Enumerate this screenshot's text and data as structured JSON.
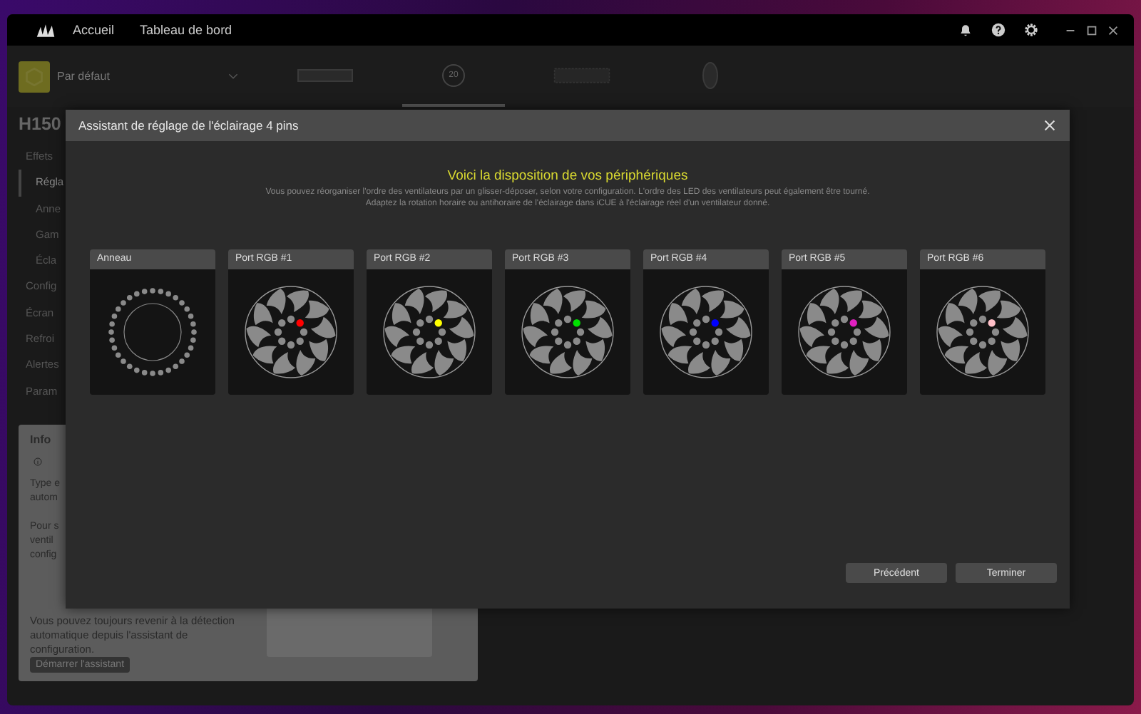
{
  "topbar": {
    "nav": [
      {
        "label": "Accueil"
      },
      {
        "label": "Tableau de bord"
      }
    ]
  },
  "profile": {
    "name": "Par défaut"
  },
  "devices": [
    {
      "kind": "ram",
      "selected": false
    },
    {
      "kind": "cooler",
      "label": "20",
      "selected": true
    },
    {
      "kind": "keyboard",
      "selected": false
    },
    {
      "kind": "mouse",
      "selected": false
    }
  ],
  "device_title": "H150",
  "sidebar": {
    "items": [
      {
        "label": "Effets",
        "selected": false,
        "children": [
          {
            "label": "Régla",
            "selected": true
          },
          {
            "label": "Anne",
            "selected": false
          },
          {
            "label": "Gam",
            "selected": false
          },
          {
            "label": "Écla",
            "selected": false
          }
        ]
      },
      {
        "label": "Config",
        "selected": false
      },
      {
        "label": "Écran",
        "selected": false
      },
      {
        "label": "Refroi",
        "selected": false
      },
      {
        "label": "Alertes",
        "selected": false
      },
      {
        "label": "Param",
        "selected": false
      }
    ]
  },
  "info": {
    "title": "Info",
    "lines": [
      "Type e",
      "autom",
      "Pour s",
      "ventil",
      "config"
    ],
    "paragraph": "Vous pouvez toujours revenir à la détection automatique depuis l'assistant de configuration.",
    "button": "Démarrer l'assistant"
  },
  "modal": {
    "title": "Assistant de réglage de l'éclairage 4 pins",
    "heading": "Voici la disposition de vos périphériques",
    "description": [
      "Vous pouvez réorganiser l'ordre des ventilateurs par un glisser-déposer, selon votre configuration. L'ordre des LED des ventilateurs peut également être tourné.",
      "Adaptez la rotation horaire ou antihoraire de l'éclairage dans iCUE à l'éclairage réel d'un ventilateur donné."
    ],
    "cards": [
      {
        "label": "Anneau",
        "kind": "ring"
      },
      {
        "label": "Port RGB #1",
        "kind": "fan",
        "color": "#ff0000"
      },
      {
        "label": "Port RGB #2",
        "kind": "fan",
        "color": "#ffff00"
      },
      {
        "label": "Port RGB #3",
        "kind": "fan",
        "color": "#00e000"
      },
      {
        "label": "Port RGB #4",
        "kind": "fan",
        "color": "#0000ff"
      },
      {
        "label": "Port RGB #5",
        "kind": "fan",
        "color": "#e020c0"
      },
      {
        "label": "Port RGB #6",
        "kind": "fan",
        "color": "#ffc0c8"
      }
    ],
    "buttons": [
      {
        "label": "Précédent"
      },
      {
        "label": "Terminer"
      }
    ]
  }
}
